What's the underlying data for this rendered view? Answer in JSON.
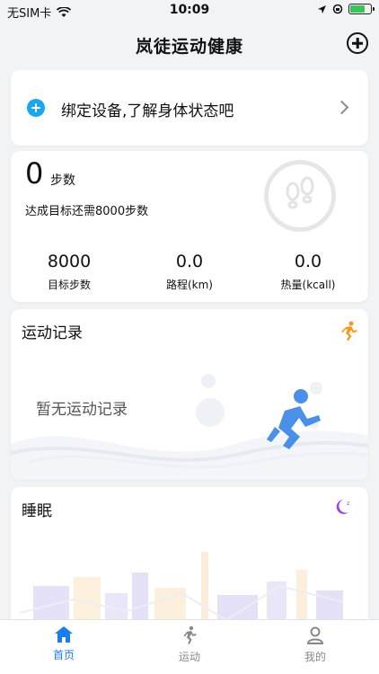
{
  "status_bar": {
    "carrier": "无SIM卡",
    "time": "10:09"
  },
  "header": {
    "title": "岚徒运动健康"
  },
  "bind_device": {
    "label": "绑定设备,了解身体状态吧"
  },
  "steps": {
    "count": "0",
    "unit": "步数",
    "goal_text": "达成目标还需8000步数",
    "stats": [
      {
        "value": "8000",
        "label": "目标步数"
      },
      {
        "value": "0.0",
        "label": "路程(km)"
      },
      {
        "value": "0.0",
        "label": "热量(kcall)"
      }
    ]
  },
  "exercise": {
    "title": "运动记录",
    "empty_text": "暂无运动记录"
  },
  "sleep": {
    "title": "睡眠"
  },
  "tabbar": {
    "items": [
      {
        "label": "首页",
        "icon": "home-icon",
        "active": true
      },
      {
        "label": "运动",
        "icon": "run-icon",
        "active": false
      },
      {
        "label": "我的",
        "icon": "user-icon",
        "active": false
      }
    ]
  },
  "colors": {
    "accent": "#1a7cf0",
    "device_plus": "#1aa6f0",
    "exercise_icon": "#f39a1e",
    "sleep_icon": "#9b3df0",
    "battery": "#3cc45a"
  }
}
